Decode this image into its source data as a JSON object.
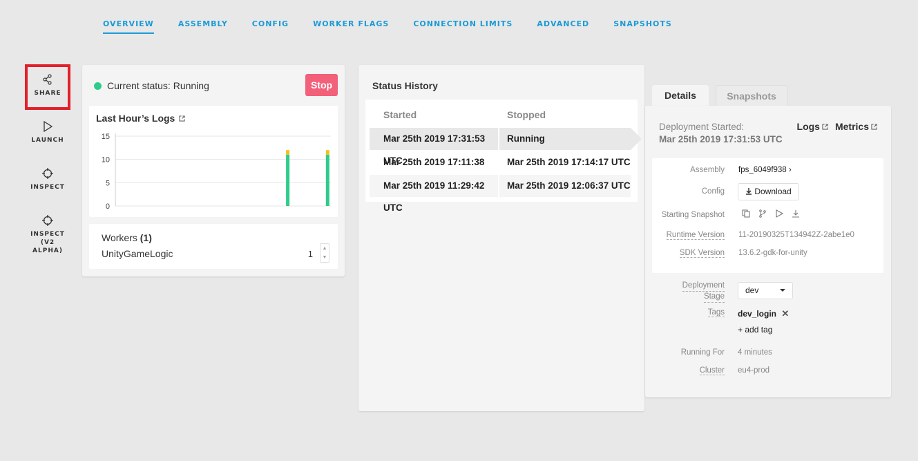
{
  "topnav": {
    "tabs": [
      "OVERVIEW",
      "ASSEMBLY",
      "CONFIG",
      "WORKER FLAGS",
      "CONNECTION LIMITS",
      "ADVANCED",
      "SNAPSHOTS"
    ],
    "active": "OVERVIEW"
  },
  "sidebar": {
    "share": "SHARE",
    "launch": "LAUNCH",
    "inspect": "INSPECT",
    "inspect2": "INSPECT\n(V2 ALPHA)"
  },
  "status": {
    "text": "Current status: Running",
    "stop_label": "Stop",
    "dot_color": "#2ecc8a"
  },
  "logs": {
    "title": "Last Hour’s Logs"
  },
  "chart_data": {
    "type": "bar",
    "title": "Last Hour’s Logs",
    "yticks": [
      "15",
      "10",
      "5",
      "0"
    ],
    "ylim": [
      0,
      15
    ],
    "grid": true,
    "series": [
      {
        "color": "#2ecc8a",
        "values": [
          11,
          11
        ]
      },
      {
        "color": "#f2c01e",
        "values": [
          1,
          1
        ]
      }
    ],
    "x_positions": [
      0.8,
      0.985
    ],
    "stacked": true
  },
  "workers": {
    "title": "Workers",
    "count": "(1)",
    "name": "UnityGameLogic",
    "value": "1"
  },
  "history": {
    "title": "Status History",
    "headers": [
      "Started",
      "Stopped"
    ],
    "rows": [
      [
        "Mar 25th 2019 17:31:53 UTC",
        "Running"
      ],
      [
        "Mar 25th 2019 17:11:38 UTC",
        "Mar 25th 2019 17:14:17 UTC"
      ],
      [
        "Mar 25th 2019 11:29:42 UTC",
        "Mar 25th 2019 12:06:37 UTC"
      ]
    ]
  },
  "details": {
    "tab_details": "Details",
    "tab_snapshots": "Snapshots",
    "dep_started_label": "Deployment Started:",
    "dep_started_value": "Mar 25th 2019 17:31:53 UTC",
    "logs_link": "Logs",
    "metrics_link": "Metrics",
    "assembly_label": "Assembly",
    "assembly_value": "fps_6049f938 ›",
    "config_label": "Config",
    "download_label": "Download",
    "starting_snapshot_label": "Starting Snapshot",
    "runtime_label": "Runtime Version",
    "runtime_value": "11-20190325T134942Z-2abe1e0",
    "sdk_label": "SDK Version",
    "sdk_value": "13.6.2-gdk-for-unity",
    "stage_label_1": "Deployment",
    "stage_label_2": "Stage",
    "stage_value": "dev",
    "tags_label": "Tags",
    "tag_value": "dev_login",
    "add_tag": "+ add tag",
    "running_for_label": "Running For",
    "running_for_value": "4 minutes",
    "cluster_label": "Cluster",
    "cluster_value": "eu4-prod"
  }
}
